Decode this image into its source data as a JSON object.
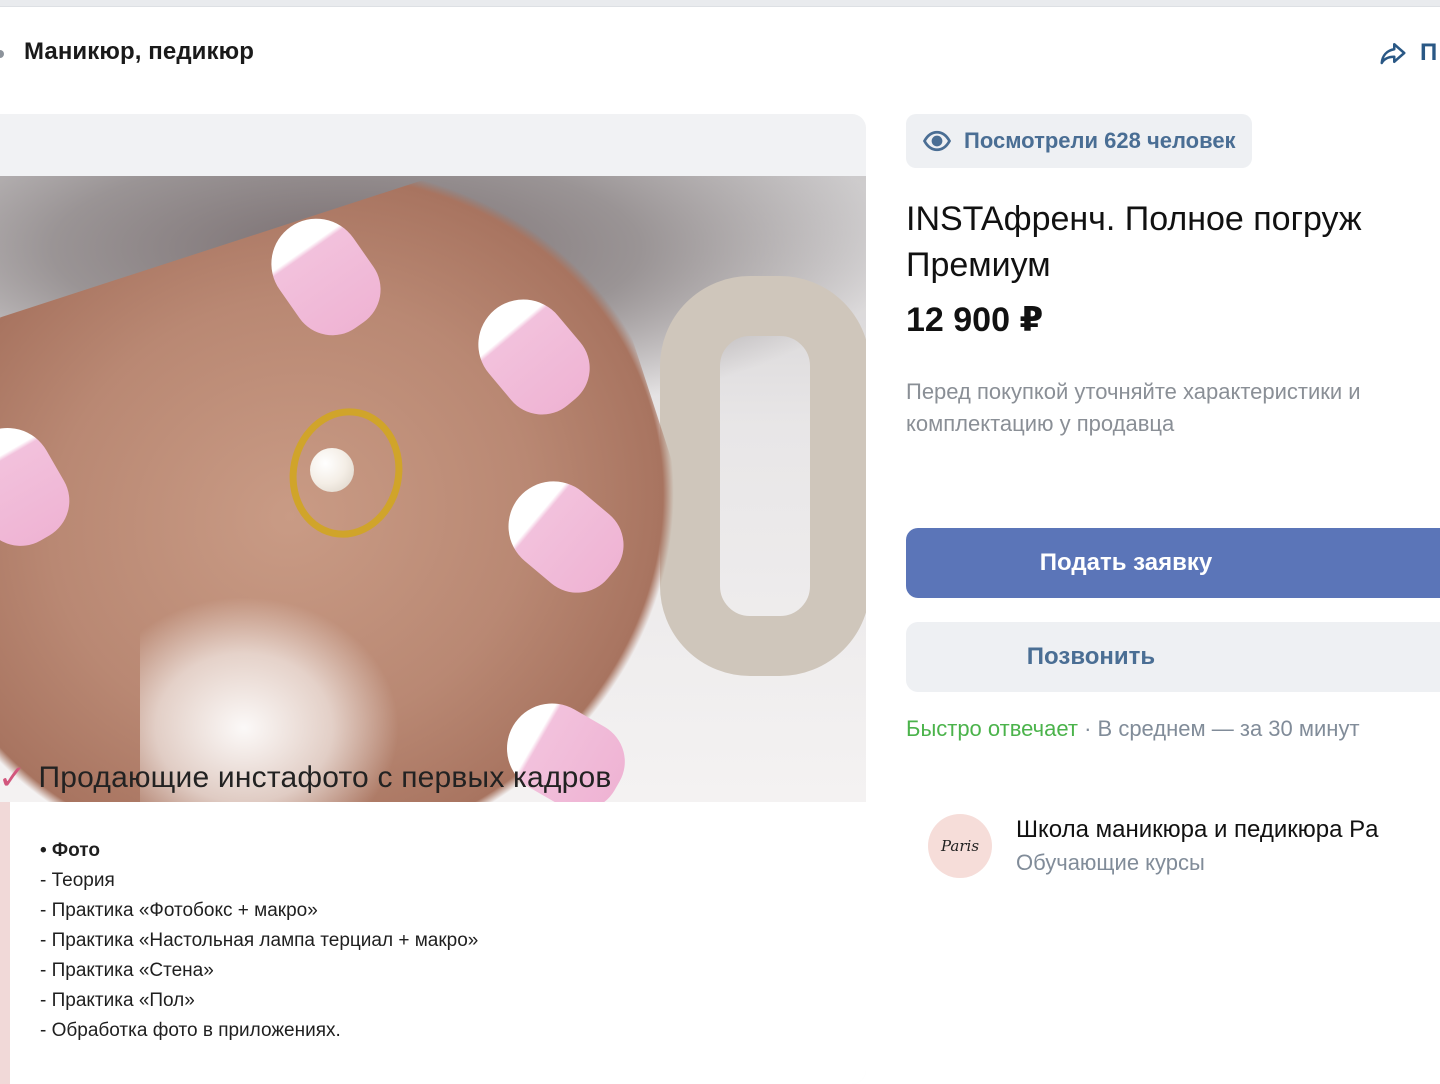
{
  "breadcrumb": {
    "label": "Маникюр, педикюр"
  },
  "share": {
    "label": "П"
  },
  "product": {
    "views": "Посмотрели 628 человек",
    "title": "INSTAфренч. Полное погруж",
    "title_line2": "Премиум",
    "price": "12 900 ₽",
    "hint": "Перед покупкой уточняйте характеристики и комплектацию у продавца"
  },
  "actions": {
    "apply_label": "Подать заявку",
    "call_label": "Позвонить"
  },
  "response": {
    "fast": "Быстро отвечает",
    "separator": " · ",
    "average": "В среднем — за 30 минут"
  },
  "seller": {
    "name": "Школа маникюра и педикюра Pa",
    "category": "Обучающие курсы",
    "avatar_text": "Paris"
  },
  "image": {
    "promo_text": "Продающие инстафото с первых кадров",
    "lines": [
      "• Фото",
      "- Теория",
      " - Практика «Фотобокс + макро»",
      " - Практика «Настольная лампа терциал + макро»",
      " - Практика «Стена»",
      " - Практика «Пол»",
      " - Обработка фото в приложениях."
    ]
  },
  "colors": {
    "primary_button": "#5b75b8",
    "link": "#4a6e94",
    "fast_green": "#4bb34b"
  },
  "icons": [
    "eye-icon",
    "share-icon",
    "check-icon"
  ]
}
